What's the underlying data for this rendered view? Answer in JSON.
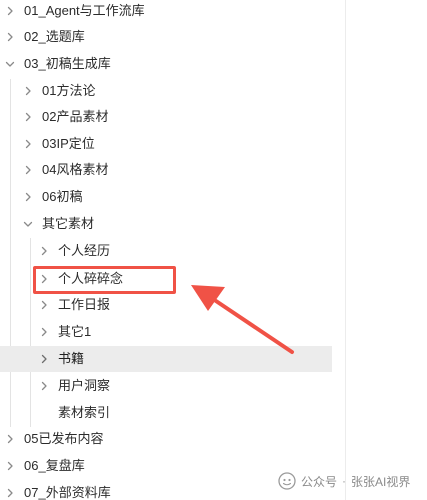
{
  "tree": {
    "items": [
      {
        "label": "01_Agent与工作流库",
        "chevron": "right"
      },
      {
        "label": "02_选题库",
        "chevron": "right"
      },
      {
        "label": "03_初稿生成库",
        "chevron": "down"
      },
      {
        "label": "01方法论",
        "chevron": "right"
      },
      {
        "label": "02产品素材",
        "chevron": "right"
      },
      {
        "label": "03IP定位",
        "chevron": "right"
      },
      {
        "label": "04风格素材",
        "chevron": "right"
      },
      {
        "label": "06初稿",
        "chevron": "right"
      },
      {
        "label": "其它素材",
        "chevron": "down"
      },
      {
        "label": "个人经历",
        "chevron": "right"
      },
      {
        "label": "个人碎碎念",
        "chevron": "right",
        "highlighted": true
      },
      {
        "label": "工作日报",
        "chevron": "right"
      },
      {
        "label": "其它1",
        "chevron": "right"
      },
      {
        "label": "书籍",
        "chevron": "right",
        "selected": true
      },
      {
        "label": "用户洞察",
        "chevron": "right"
      },
      {
        "label": "素材索引",
        "chevron": "none"
      },
      {
        "label": "05已发布内容",
        "chevron": "right"
      },
      {
        "label": "06_复盘库",
        "chevron": "right"
      },
      {
        "label": "07_外部资料库",
        "chevron": "right"
      }
    ]
  },
  "annotation": {
    "color": "#f05246"
  },
  "watermark": {
    "platform": "公众号",
    "separator": "·",
    "account": "张张AI视界"
  },
  "colors": {
    "selected_row": "#ececec",
    "chevron": "#8a8a8a",
    "text": "#2b2b2b"
  }
}
